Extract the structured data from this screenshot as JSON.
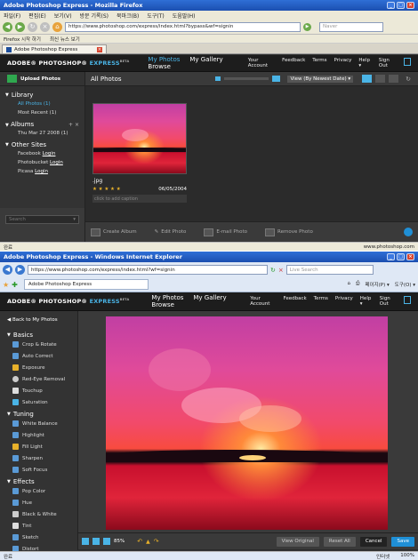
{
  "firefox": {
    "title": "Adobe Photoshop Express - Mozilla Firefox",
    "menu": [
      "파일(F)",
      "편집(E)",
      "보기(V)",
      "방문 기록(S)",
      "북마크(B)",
      "도구(T)",
      "도움말(H)"
    ],
    "url": "https://www.photoshop.com/express/index.html?bypass&wf=signin",
    "search_placeholder": "Naver",
    "bookmarks": [
      "Firefox 시작 하기",
      "최신 뉴스 보기"
    ],
    "tab_label": "Adobe Photoshop Express",
    "status_left": "완료",
    "status_right": "www.photoshop.com"
  },
  "app": {
    "logo_main": "ADOBE® PHOTOSHOP®",
    "logo_express": "EXPRESS",
    "logo_beta": "BETA",
    "nav": [
      "My Photos",
      "My Gallery",
      "Browse"
    ],
    "right_nav": [
      "Your Account",
      "Feedback",
      "Terms",
      "Privacy",
      "Help ▾",
      "Sign Out"
    ],
    "upload_label": "Upload Photos",
    "all_photos_title": "All Photos",
    "view_label": "View (By Newest Date)",
    "library_title": "Library",
    "library_items": [
      "All Photos (1)",
      "Most Recent (1)"
    ],
    "albums_title": "Albums",
    "albums_items": [
      "Thu Mar 27 2008 (1)"
    ],
    "other_sites_title": "Other Sites",
    "other_sites_items": [
      {
        "name": "Facebook",
        "action": "Login"
      },
      {
        "name": "Photobucket",
        "action": "Login"
      },
      {
        "name": "Picasa",
        "action": "Login"
      }
    ],
    "search_placeholder": "Search",
    "photo": {
      "filename": ".jpg",
      "rating": "★ ★ ★ ★ ★",
      "date": "06/05/2004",
      "caption_placeholder": "click to add caption"
    },
    "bottom_buttons": [
      "Create Album",
      "Edit Photo",
      "E-mail Photo",
      "Remove Photo"
    ]
  },
  "ie": {
    "title": "Adobe Photoshop Express - Windows Internet Explorer",
    "url": "https://www.photoshop.com/express/index.html?wf=signin",
    "search_placeholder": "Live Search",
    "tab_label": "Adobe Photoshop Express",
    "tools_right": [
      "페이지(P) ▾",
      "도구(O) ▾"
    ],
    "status_left": "완료",
    "status_zone": "인터넷",
    "zoom": "100%"
  },
  "editor": {
    "back_label": "Back to My Photos",
    "basics_title": "Basics",
    "basics": [
      "Crop & Rotate",
      "Auto Correct",
      "Exposure",
      "Red-Eye Removal",
      "Touchup",
      "Saturation"
    ],
    "tuning_title": "Tuning",
    "tuning": [
      "White Balance",
      "Highlight",
      "Fill Light",
      "Sharpen",
      "Soft Focus"
    ],
    "effects_title": "Effects",
    "effects": [
      "Pop Color",
      "Hue",
      "Black & White",
      "Tint",
      "Sketch",
      "Distort"
    ],
    "zoom_value": "85%",
    "view_original": "View Original",
    "reset_all": "Reset All",
    "cancel": "Cancel",
    "save": "Save"
  },
  "colors": {
    "accent": "#4ab4e6",
    "save": "#1f8fd6",
    "cancel": "#222222"
  }
}
